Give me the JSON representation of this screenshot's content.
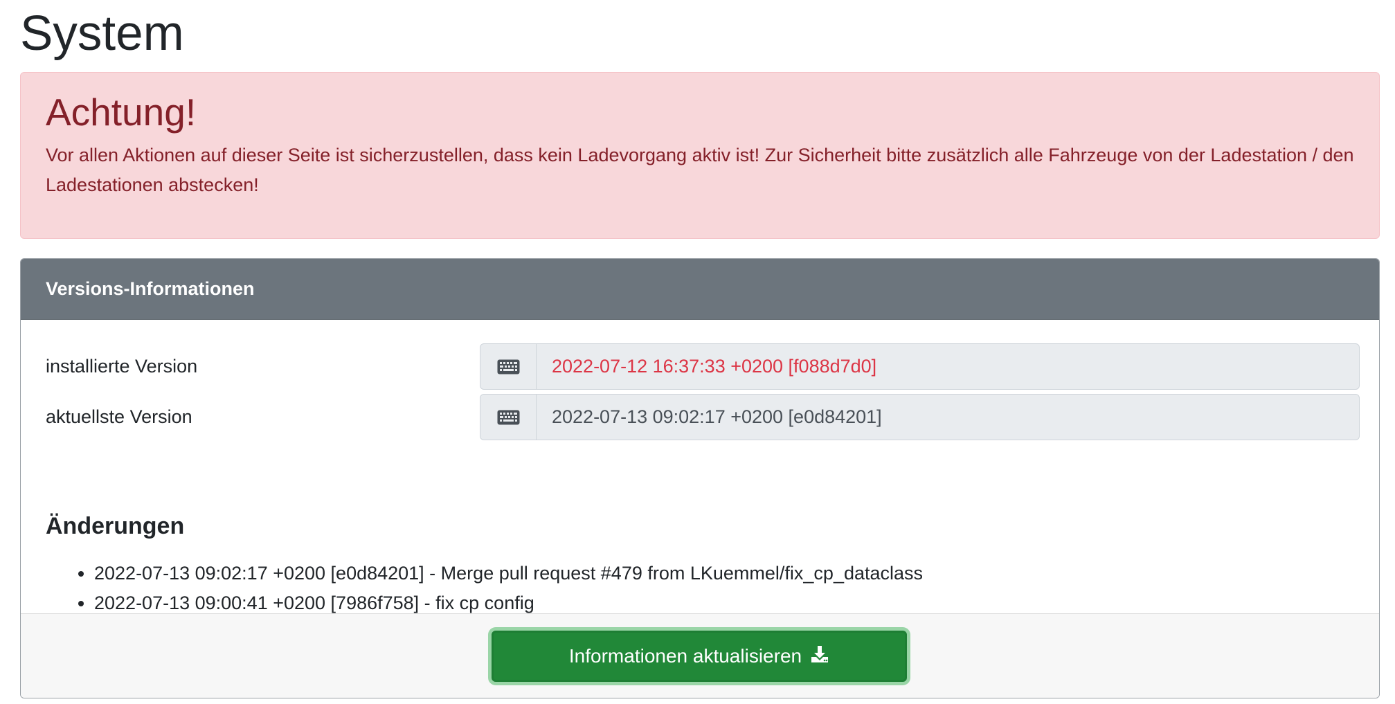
{
  "page": {
    "title": "System"
  },
  "alert": {
    "heading": "Achtung!",
    "text": "Vor allen Aktionen auf dieser Seite ist sicherzustellen, dass kein Ladevorgang aktiv ist! Zur Sicherheit bitte zusätzlich alle Fahrzeuge von der Ladestation / den Ladestationen abstecken!",
    "color": "#842029",
    "background": "#f8d7da"
  },
  "versions": {
    "header": "Versions-Informationen",
    "header_background": "#6c757d",
    "installed": {
      "label": "installierte Version",
      "icon": "keyboard-icon",
      "value": "2022-07-12 16:37:33 +0200 [f088d7d0]",
      "value_color": "#dc3545"
    },
    "latest": {
      "label": "aktuellste Version",
      "icon": "keyboard-icon",
      "value": "2022-07-13 09:02:17 +0200 [e0d84201]"
    },
    "changes_heading": "Änderungen",
    "changes": [
      "2022-07-13 09:02:17 +0200 [e0d84201] - Merge pull request #479 from LKuemmel/fix_cp_dataclass",
      "2022-07-13 09:00:41 +0200 [7986f758] - fix cp config"
    ],
    "update_button": {
      "label": "Informationen aktualisieren",
      "icon": "download-icon",
      "color": "#218838"
    }
  }
}
